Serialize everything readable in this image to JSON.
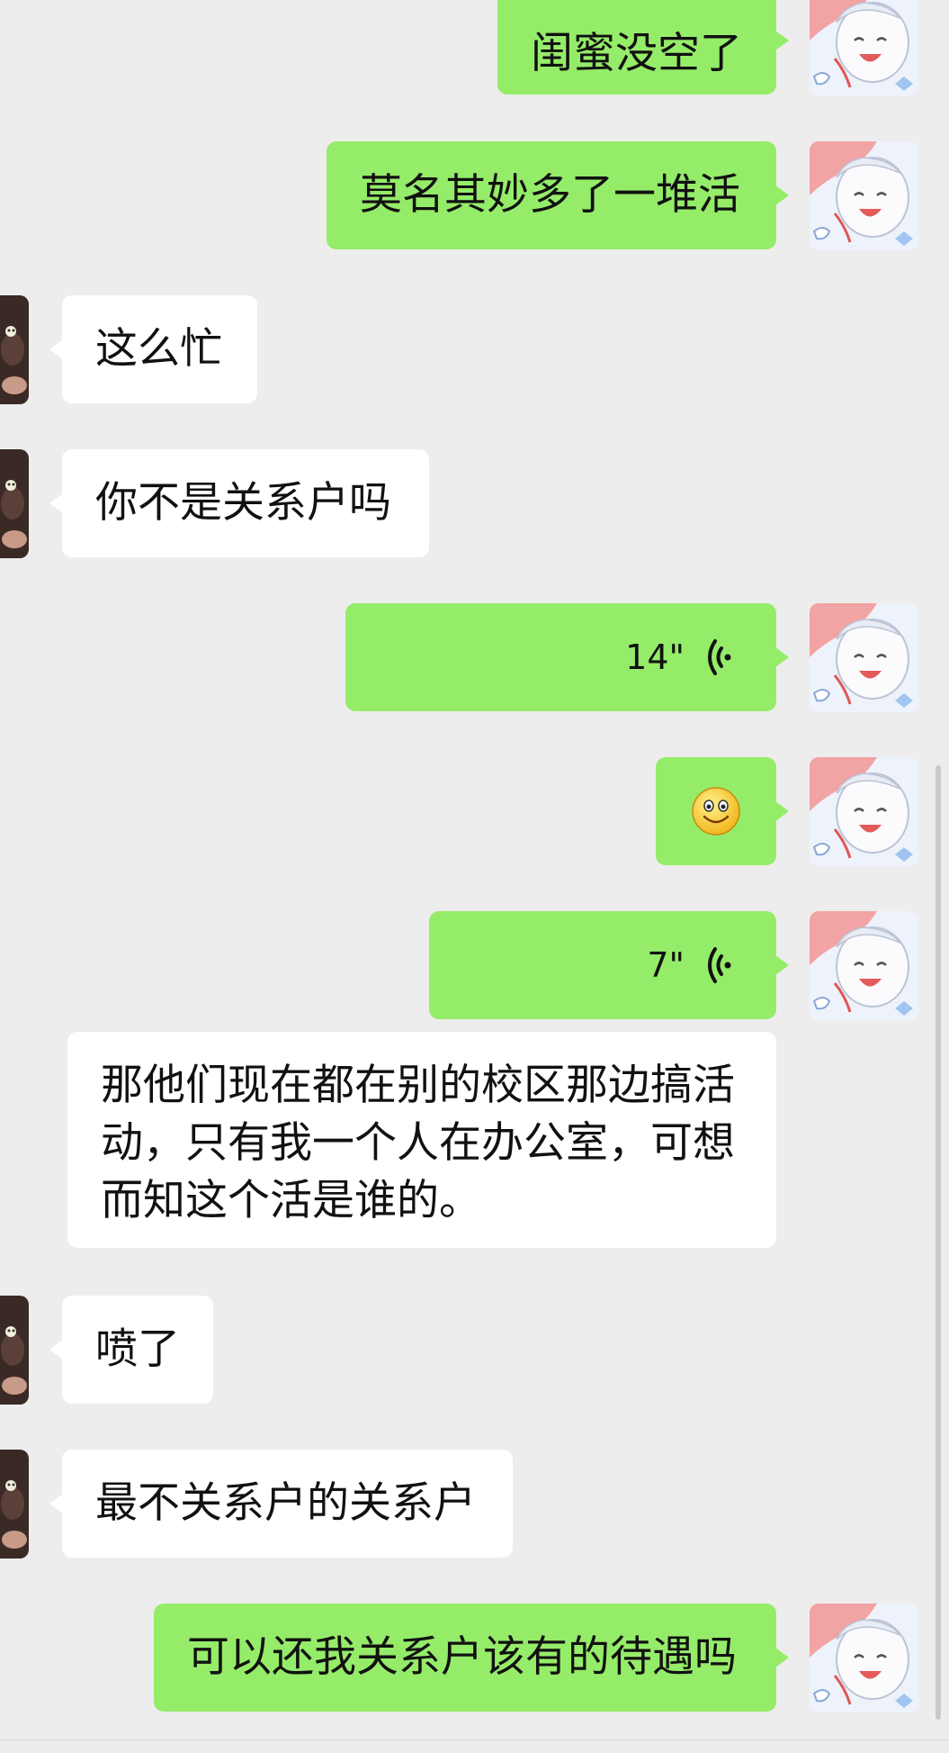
{
  "messages": [
    {
      "id": "m1",
      "side": "me",
      "text": "闺蜜没空了"
    },
    {
      "id": "m2",
      "side": "me",
      "text": "莫名其妙多了一堆活"
    },
    {
      "id": "m3",
      "side": "them",
      "text": "这么忙"
    },
    {
      "id": "m4",
      "side": "them",
      "text": "你不是关系户吗"
    },
    {
      "id": "m5",
      "side": "me",
      "type": "voice",
      "duration": "14\""
    },
    {
      "id": "m6",
      "side": "me",
      "type": "emoji",
      "emoji": "smile-emoji"
    },
    {
      "id": "m7",
      "side": "me",
      "type": "voice",
      "duration": "7\""
    },
    {
      "id": "m8",
      "side": "them",
      "text": "那他们现在都在别的校区那边搞活动，只有我一个人在办公室，可想而知这个活是谁的。"
    },
    {
      "id": "m9",
      "side": "them",
      "text": "喷了"
    },
    {
      "id": "m10",
      "side": "them",
      "text": "最不关系户的关系户"
    },
    {
      "id": "m11",
      "side": "me",
      "text": "可以还我关系户该有的待遇吗"
    }
  ],
  "colors": {
    "background": "#ededed",
    "sent_bubble": "#95ec69",
    "received_bubble": "#ffffff"
  }
}
